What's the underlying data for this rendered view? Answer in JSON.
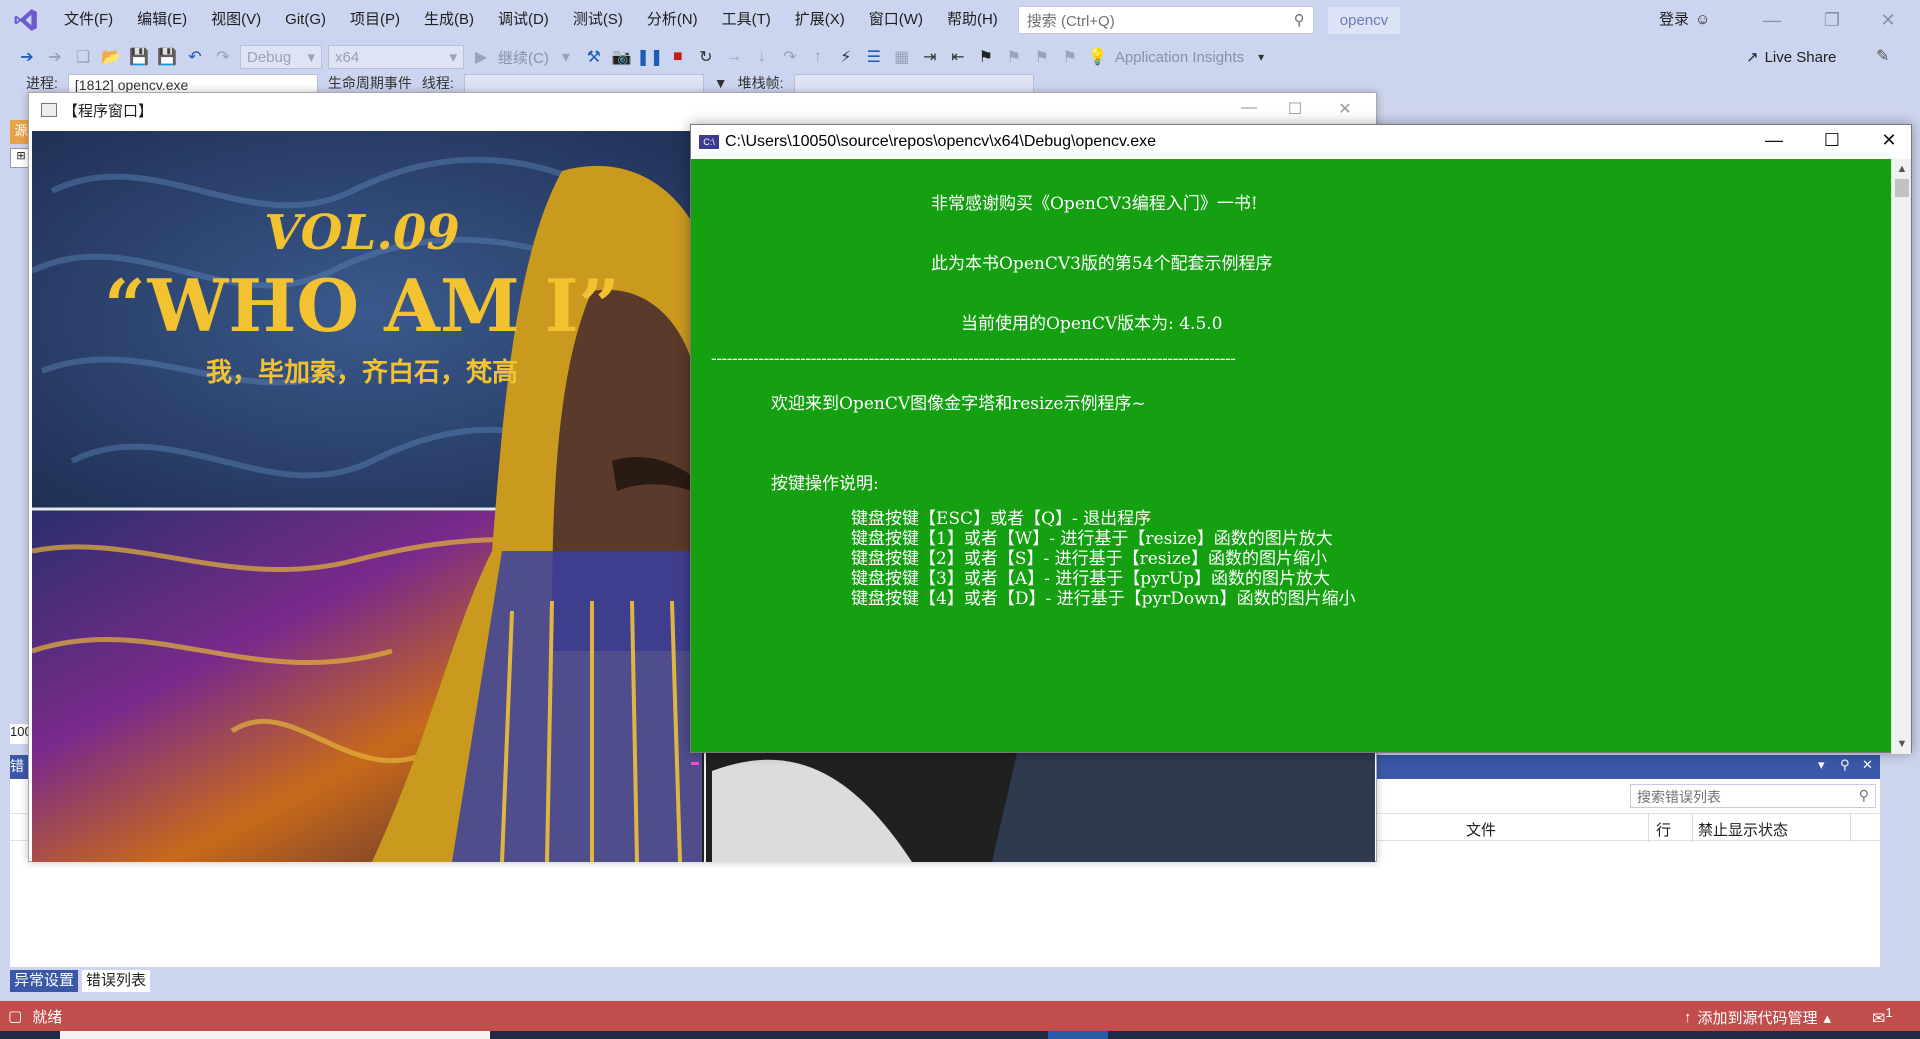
{
  "menubar": {
    "items": [
      "文件(F)",
      "编辑(E)",
      "视图(V)",
      "Git(G)",
      "项目(P)",
      "生成(B)",
      "调试(D)",
      "测试(S)",
      "分析(N)",
      "工具(T)",
      "扩展(X)",
      "窗口(W)",
      "帮助(H)"
    ],
    "search_placeholder": "搜索 (Ctrl+Q)",
    "solution_name": "opencv",
    "login": "登录"
  },
  "toolbar": {
    "config": "Debug",
    "platform": "x64",
    "continue": "继续(C)",
    "app_insights": "Application Insights",
    "live_share": "Live Share"
  },
  "debugbar": {
    "process_label": "进程:",
    "process_value": "[1812] opencv.exe",
    "lifecycle": "生命周期事件",
    "thread_label": "线程:",
    "stackframe_label": "堆栈帧:"
  },
  "side": {
    "tab1": "源",
    "zoom": "100",
    "error_tab": "错"
  },
  "prog_window": {
    "title": "【程序窗口】",
    "image": {
      "vol": "VOL.09",
      "headline": "“WHO AM I”",
      "subtitle": "我，毕加索，齐白石，梵高"
    }
  },
  "console": {
    "title": "C:\\Users\\10050\\source\\repos\\opencv\\x64\\Debug\\opencv.exe",
    "line1": "非常感谢购买《OpenCV3编程入门》一书!",
    "line2": "此为本书OpenCV3版的第54个配套示例程序",
    "line3": "当前使用的OpenCV版本为: 4.5.0",
    "divider": "----------------------------------------------------------------------------------------------------",
    "welcome": "欢迎来到OpenCV图像金字塔和resize示例程序~",
    "keys_title": "按键操作说明:",
    "keys": [
      "键盘按键【ESC】或者【Q】- 退出程序",
      "键盘按键【1】或者【W】- 进行基于【resize】函数的图片放大",
      "键盘按键【2】或者【S】- 进行基于【resize】函数的图片缩小",
      "键盘按键【3】或者【A】- 进行基于【pyrUp】函数的图片放大",
      "键盘按键【4】或者【D】- 进行基于【pyrDown】函数的图片缩小"
    ]
  },
  "error_list": {
    "search_placeholder": "搜索错误列表",
    "col_file": "文件",
    "col_line": "行",
    "col_suppress": "禁止显示状态"
  },
  "bottom_tabs": [
    "异常设置",
    "错误列表"
  ],
  "statusbar": {
    "ready": "就绪",
    "source_control": "添加到源代码管理",
    "notify_count": "1"
  },
  "colors": {
    "console_bg": "#14a011",
    "status_bg": "#c14d4d",
    "chrome_bg": "#ccd5f0",
    "panel_accent": "#3b58a8"
  }
}
